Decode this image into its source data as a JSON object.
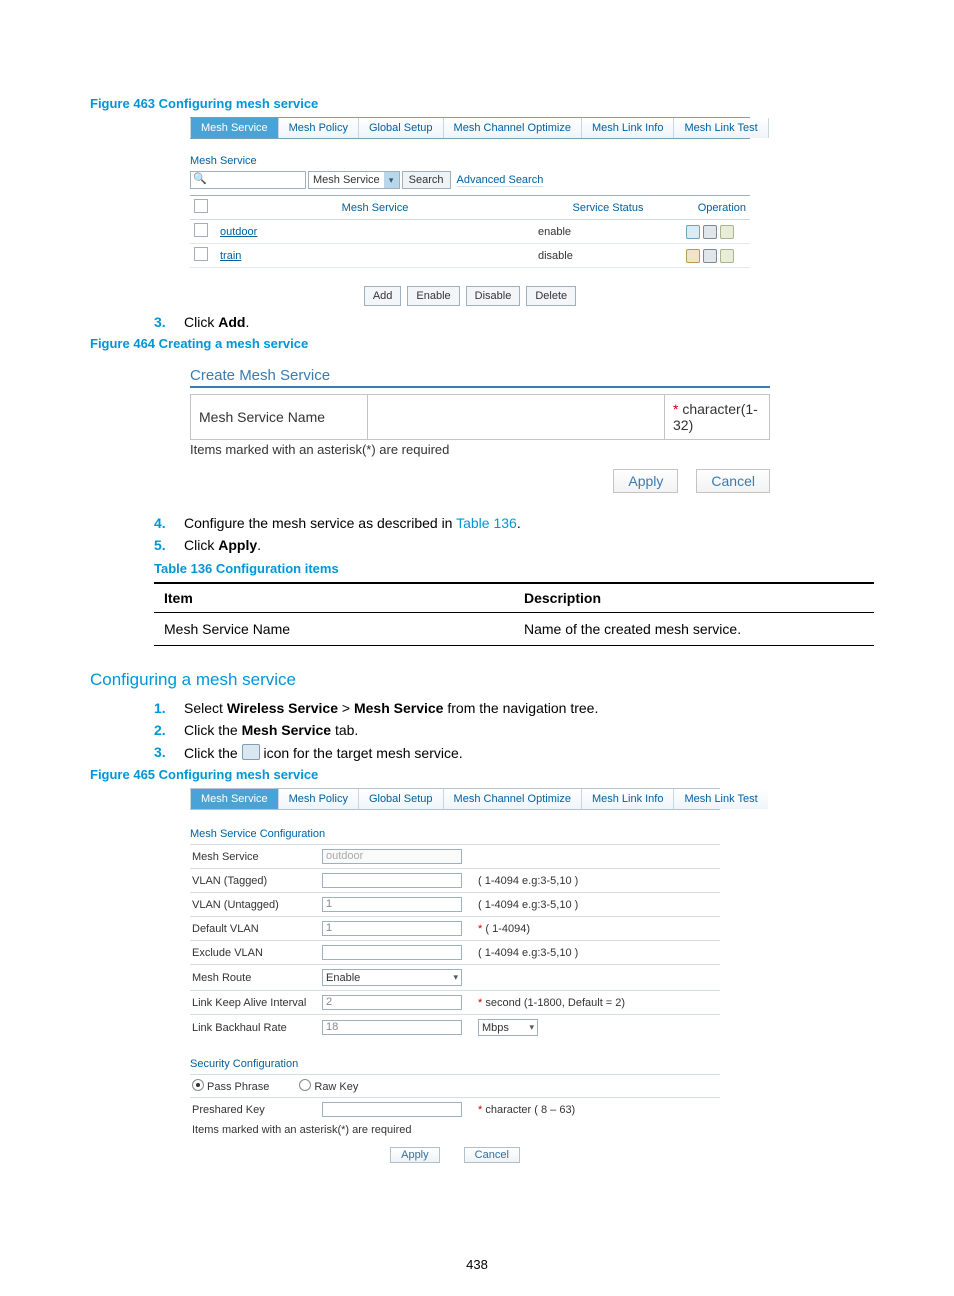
{
  "page_number": "438",
  "figures": {
    "fig463": {
      "caption": "Figure 463 Configuring mesh service"
    },
    "fig464": {
      "caption": "Figure 464 Creating a mesh service"
    },
    "fig465": {
      "caption": "Figure 465 Configuring mesh service"
    }
  },
  "tabs": {
    "mesh_service": "Mesh Service",
    "mesh_policy": "Mesh Policy",
    "global_setup": "Global Setup",
    "mesh_channel_optimize": "Mesh Channel Optimize",
    "mesh_link_info": "Mesh Link Info",
    "mesh_link_test": "Mesh Link Test"
  },
  "fig463_panel": {
    "sublabel": "Mesh Service",
    "search_drop": "Mesh Service",
    "search_btn": "Search",
    "advanced": "Advanced Search",
    "columns": {
      "name": "Mesh Service",
      "status": "Service Status",
      "operation": "Operation"
    },
    "rows": [
      {
        "name": "outdoor",
        "status": "enable"
      },
      {
        "name": "train",
        "status": "disable"
      }
    ],
    "buttons": {
      "add": "Add",
      "enable": "Enable",
      "disable": "Disable",
      "delete": "Delete"
    }
  },
  "steps_top": {
    "s3_prefix": "Click ",
    "s3_bold": "Add",
    "s3_suffix": "."
  },
  "fig464_panel": {
    "title": "Create Mesh Service",
    "field_label": "Mesh Service Name",
    "constraint_star": "*",
    "constraint_text": " character(1-32)",
    "note": "Items marked with an asterisk(*) are required",
    "apply": "Apply",
    "cancel": "Cancel"
  },
  "steps_mid": {
    "s4_prefix": "Configure the mesh service as described in ",
    "s4_link": "Table 136",
    "s4_suffix": ".",
    "s5_prefix": "Click ",
    "s5_bold": "Apply",
    "s5_suffix": "."
  },
  "table136": {
    "caption": "Table 136 Configuration items",
    "headers": {
      "item": "Item",
      "description": "Description"
    },
    "row": {
      "item": "Mesh Service Name",
      "description": "Name of the created mesh service."
    }
  },
  "section_head": "Configuring a mesh service",
  "steps_bottom": {
    "s1_prefix": "Select ",
    "s1_bold1": "Wireless Service",
    "s1_sep": " > ",
    "s1_bold2": "Mesh Service",
    "s1_suffix": " from the navigation tree.",
    "s2_prefix": "Click the ",
    "s2_bold": "Mesh Service",
    "s2_suffix": " tab.",
    "s3_prefix": "Click the ",
    "s3_suffix": " icon for the target mesh service."
  },
  "fig465_panel": {
    "section1": "Mesh Service Configuration",
    "rows": {
      "mesh_service": {
        "label": "Mesh Service",
        "value": "outdoor"
      },
      "vlan_tagged": {
        "label": "VLAN (Tagged)",
        "hint": "( 1-4094 e.g:3-5,10 )"
      },
      "vlan_untagged": {
        "label": "VLAN (Untagged)",
        "value": "1",
        "hint": "( 1-4094 e.g:3-5,10 )"
      },
      "default_vlan": {
        "label": "Default VLAN",
        "value": "1",
        "hint": "( 1-4094)",
        "star": "*"
      },
      "exclude_vlan": {
        "label": "Exclude VLAN",
        "hint": "( 1-4094 e.g:3-5,10 )"
      },
      "mesh_route": {
        "label": "Mesh Route",
        "value": "Enable"
      },
      "link_keep_alive": {
        "label": "Link Keep Alive Interval",
        "value": "2",
        "hint": "second (1-1800, Default = 2)",
        "star": "*"
      },
      "link_backhaul_rate": {
        "label": "Link Backhaul Rate",
        "value": "18",
        "unit": "Mbps"
      }
    },
    "section2": "Security Configuration",
    "radios": {
      "pass_phrase": "Pass Phrase",
      "raw_key": "Raw Key"
    },
    "preshared": {
      "label": "Preshared Key",
      "hint": "character ( 8 – 63)",
      "star": "*"
    },
    "note": "Items marked with an asterisk(*) are required",
    "apply": "Apply",
    "cancel": "Cancel"
  }
}
